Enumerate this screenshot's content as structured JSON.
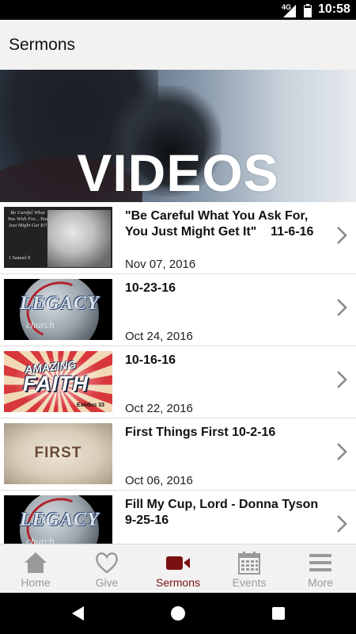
{
  "status_bar": {
    "network": "4G",
    "time": "10:58"
  },
  "app_bar": {
    "title": "Sermons"
  },
  "banner": {
    "text": "VIDEOS"
  },
  "sermons": [
    {
      "title": "\"Be Careful What You Ask For, You Just Might Get It\"    11-6-16",
      "date": "Nov 07, 2016",
      "thumbnail": {
        "caption": "Be Careful What You Wish For... You Just Might Get It!!",
        "reference": "1 Samuel 8"
      }
    },
    {
      "title": "10-23-16",
      "date": "Oct 24, 2016",
      "thumbnail": {
        "word": "LEGACY",
        "subword": "church"
      }
    },
    {
      "title": "10-16-16",
      "date": "Oct 22, 2016",
      "thumbnail": {
        "top_word": "AMAZING",
        "main_word": "FAITH",
        "verse": "Exodus 33"
      }
    },
    {
      "title": "First Things First 10-2-16",
      "date": "Oct 06, 2016",
      "thumbnail": {
        "word": "FIRST"
      }
    },
    {
      "title": "Fill My Cup, Lord - Donna Tyson 9-25-16",
      "date": "",
      "thumbnail": {
        "word": "LEGACY",
        "subword": "church"
      }
    }
  ],
  "bottom_nav": {
    "items": [
      {
        "label": "Home",
        "icon": "home-icon"
      },
      {
        "label": "Give",
        "icon": "heart-icon"
      },
      {
        "label": "Sermons",
        "icon": "video-camera-icon",
        "active": true
      },
      {
        "label": "Events",
        "icon": "calendar-icon"
      },
      {
        "label": "More",
        "icon": "menu-icon"
      }
    ]
  },
  "colors": {
    "active": "#7a1010",
    "inactive": "#9a9a9a",
    "app_bar_bg": "#f2f2f2"
  }
}
